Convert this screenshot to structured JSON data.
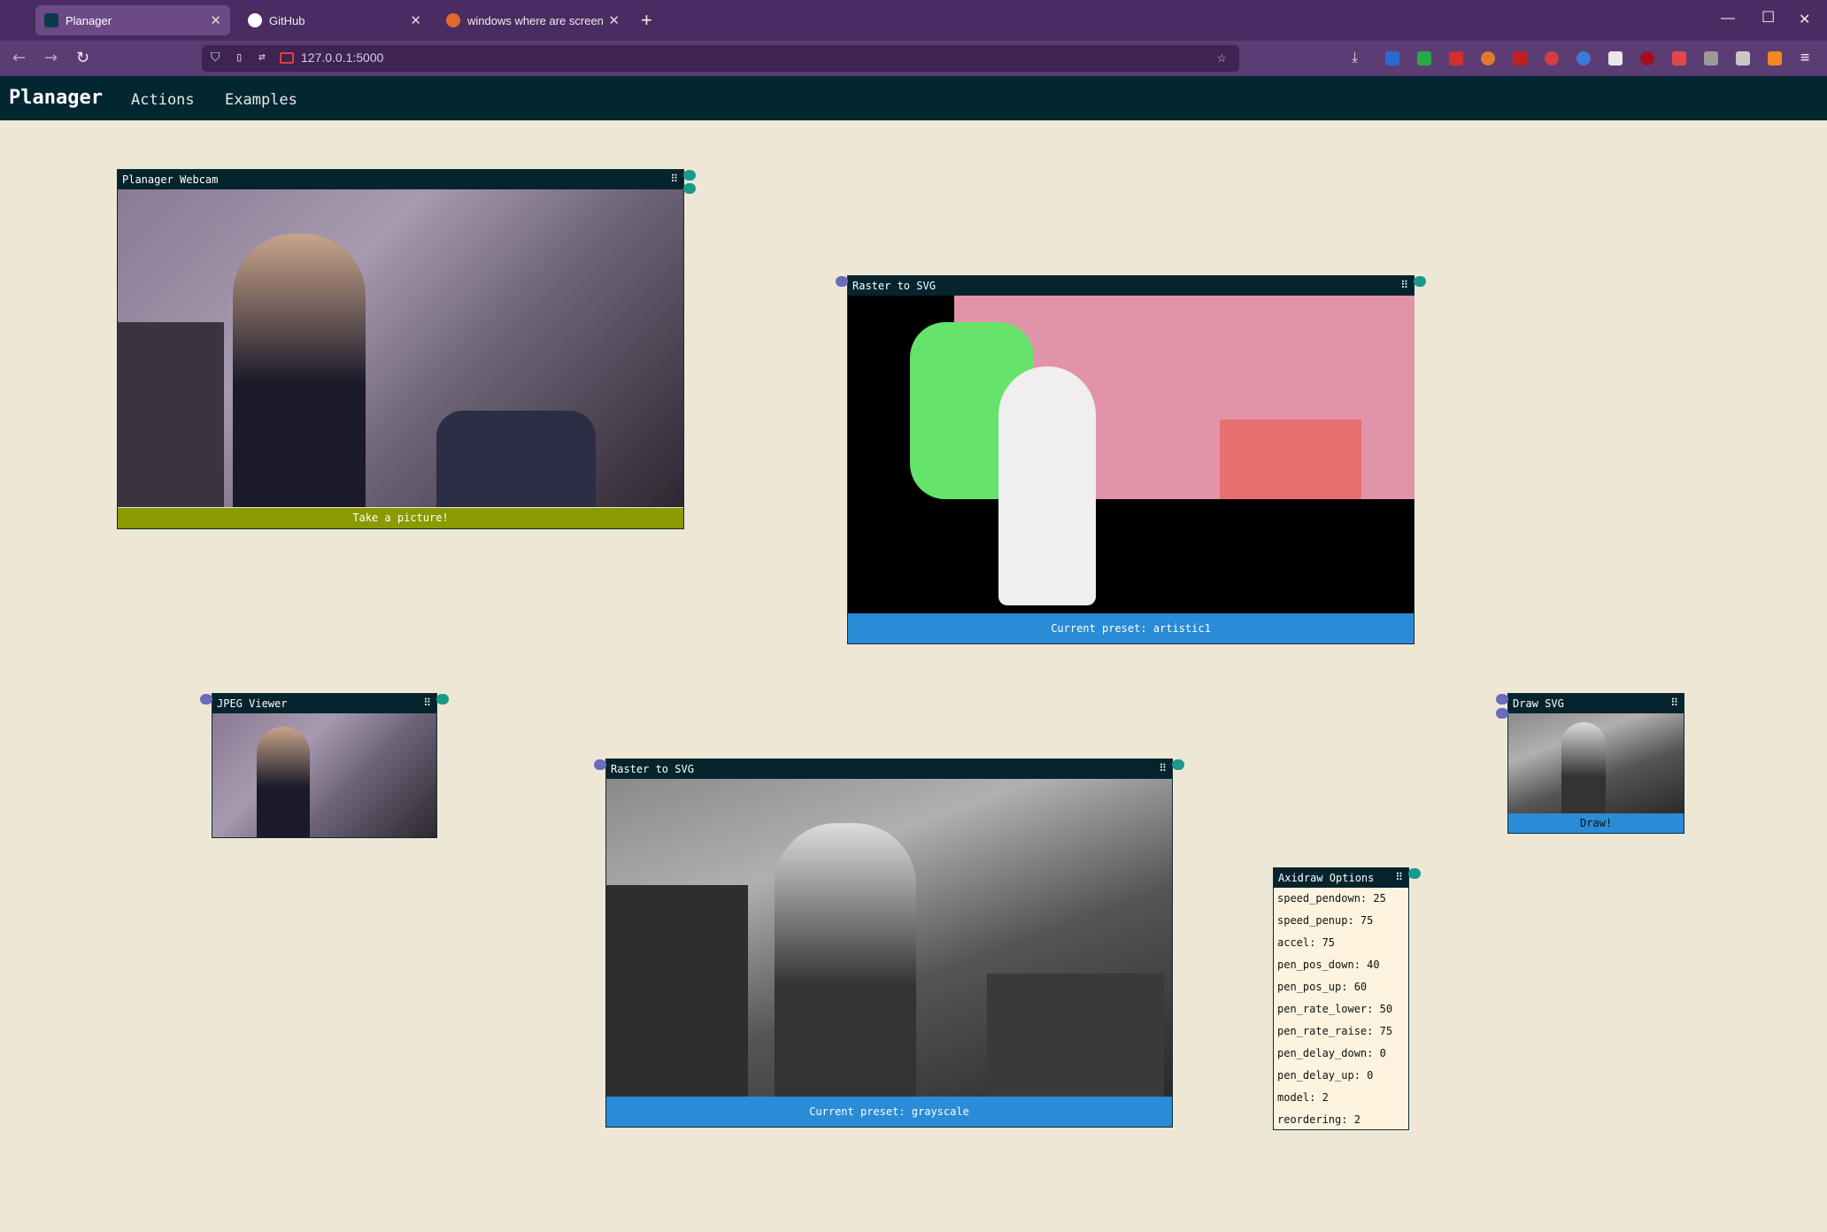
{
  "browser": {
    "tabs": [
      {
        "title": "Planager",
        "active": true
      },
      {
        "title": "GitHub",
        "active": false
      },
      {
        "title": "windows where are screenshots",
        "active": false
      }
    ],
    "url": "127.0.0.1:5000"
  },
  "app": {
    "brand": "Planager",
    "nav": [
      "Actions",
      "Examples"
    ]
  },
  "nodes": {
    "webcam": {
      "title": "Planager Webcam",
      "button": "Take a picture!"
    },
    "raster_color": {
      "title": "Raster to SVG",
      "footer": "Current preset: artistic1"
    },
    "jpeg_viewer": {
      "title": "JPEG Viewer"
    },
    "raster_gray": {
      "title": "Raster to SVG",
      "footer": "Current preset: grayscale"
    },
    "draw_svg": {
      "title": "Draw SVG",
      "button": "Draw!"
    },
    "axidraw": {
      "title": "Axidraw Options",
      "options": [
        "speed_pendown: 25",
        "speed_penup: 75",
        "accel: 75",
        "pen_pos_down: 40",
        "pen_pos_up: 60",
        "pen_rate_lower: 50",
        "pen_rate_raise: 75",
        "pen_delay_down: 0",
        "pen_delay_up: 0",
        "model: 2",
        "reordering: 2"
      ]
    }
  },
  "colors": {
    "nav_bg": "#032731",
    "canvas_bg": "#efe7d6",
    "button_olive": "#8a9a00",
    "footer_blue": "#2a8bd6",
    "port_in": "#6a6bbd",
    "port_out": "#1a9a8a"
  }
}
